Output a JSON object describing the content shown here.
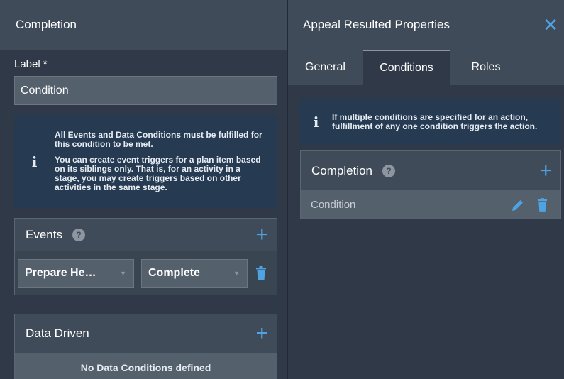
{
  "left_panel": {
    "title": "Completion",
    "label_field": {
      "label": "Label",
      "required_mark": "*",
      "value": "Condition"
    },
    "info": {
      "icon": "info-icon",
      "paragraph1": "All Events and Data Conditions must be fulfilled for this condition to be met.",
      "paragraph2": "You can create event triggers for a plan item based on its siblings only. That is, for an activity in a stage, you may create triggers based on other activities in the same stage."
    },
    "events": {
      "title": "Events",
      "help": "?",
      "add": "+",
      "row": {
        "item": "Prepare He…",
        "event": "Complete"
      }
    },
    "data_driven": {
      "title": "Data Driven",
      "add": "+",
      "empty": "No Data Conditions defined"
    }
  },
  "right_panel": {
    "title": "Appeal Resulted Properties",
    "close": "✕",
    "tabs": [
      "General",
      "Conditions",
      "Roles"
    ],
    "active_tab": "Conditions",
    "info": {
      "icon": "info-icon",
      "text": "If multiple conditions are specified for an action, fulfillment of any one condition triggers the action."
    },
    "completion": {
      "title": "Completion",
      "help": "?",
      "add": "+",
      "condition": "Condition"
    }
  },
  "colors": {
    "accent": "#4fa3e3",
    "header_bg": "#404b59",
    "panel_bg": "#2f3947",
    "info_bg": "#263a52"
  }
}
